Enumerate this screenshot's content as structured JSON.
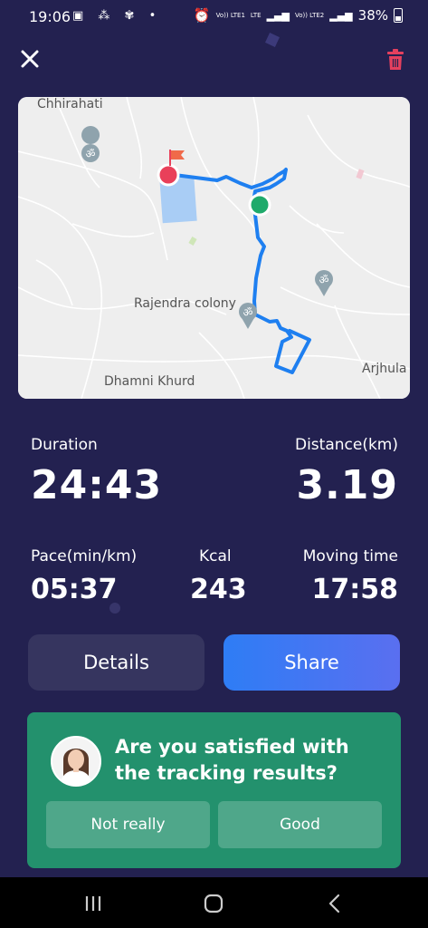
{
  "status_bar": {
    "time": "19:06",
    "battery": "38%",
    "network_labels": [
      "Vo)) LTE1",
      "LTE",
      "Vo)) LTE2"
    ]
  },
  "toolbar": {
    "close_icon": "close-icon",
    "delete_icon": "trash-icon",
    "delete_color": "#e5405e"
  },
  "map": {
    "labels": {
      "chhirahati": "Chhirahati",
      "rajendra": "Rajendra colony",
      "dhamni": "Dhamni Khurd",
      "arjhula": "Arjhula"
    },
    "route_color": "#1e7ff0",
    "start_color": "#1faa6b",
    "end_color": "#e9405a"
  },
  "stats": {
    "duration_label": "Duration",
    "duration_value": "24:43",
    "distance_label": "Distance(km)",
    "distance_value": "3.19",
    "pace_label": "Pace(min/km)",
    "pace_value": "05:37",
    "kcal_label": "Kcal",
    "kcal_value": "243",
    "moving_label": "Moving time",
    "moving_value": "17:58"
  },
  "actions": {
    "details_label": "Details",
    "share_label": "Share"
  },
  "feedback": {
    "question": "Are you satisfied with the tracking results?",
    "not_really_label": "Not really",
    "good_label": "Good"
  },
  "nav": {
    "recents_icon": "recents-icon",
    "home_icon": "home-icon",
    "back_icon": "back-icon"
  }
}
